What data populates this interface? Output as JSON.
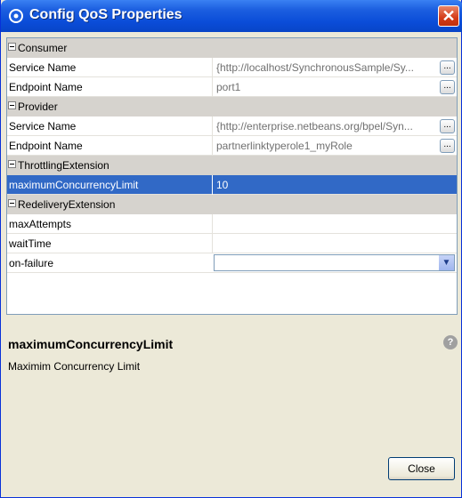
{
  "window": {
    "title": "Config QoS Properties",
    "close_glyph": "✕"
  },
  "sections": [
    {
      "label": "Consumer"
    },
    {
      "label": "Provider"
    },
    {
      "label": "ThrottlingExtension"
    },
    {
      "label": "RedeliveryExtension"
    }
  ],
  "rows": {
    "consumer_service": {
      "name": "Service Name",
      "value": "{http://localhost/SynchronousSample/Sy..."
    },
    "consumer_endpoint": {
      "name": "Endpoint Name",
      "value": "port1"
    },
    "provider_service": {
      "name": "Service Name",
      "value": "{http://enterprise.netbeans.org/bpel/Syn..."
    },
    "provider_endpoint": {
      "name": "Endpoint Name",
      "value": "partnerlinktyperole1_myRole"
    },
    "max_concurrency": {
      "name": "maximumConcurrencyLimit",
      "value": "10"
    },
    "max_attempts": {
      "name": "maxAttempts",
      "value": ""
    },
    "wait_time": {
      "name": "waitTime",
      "value": ""
    },
    "on_failure": {
      "name": "on-failure",
      "value": ""
    }
  },
  "ellipsis_label": "...",
  "description": {
    "title": "maximumConcurrencyLimit",
    "text": "Maximim Concurrency Limit",
    "help_glyph": "?"
  },
  "footer": {
    "close_label": "Close"
  }
}
